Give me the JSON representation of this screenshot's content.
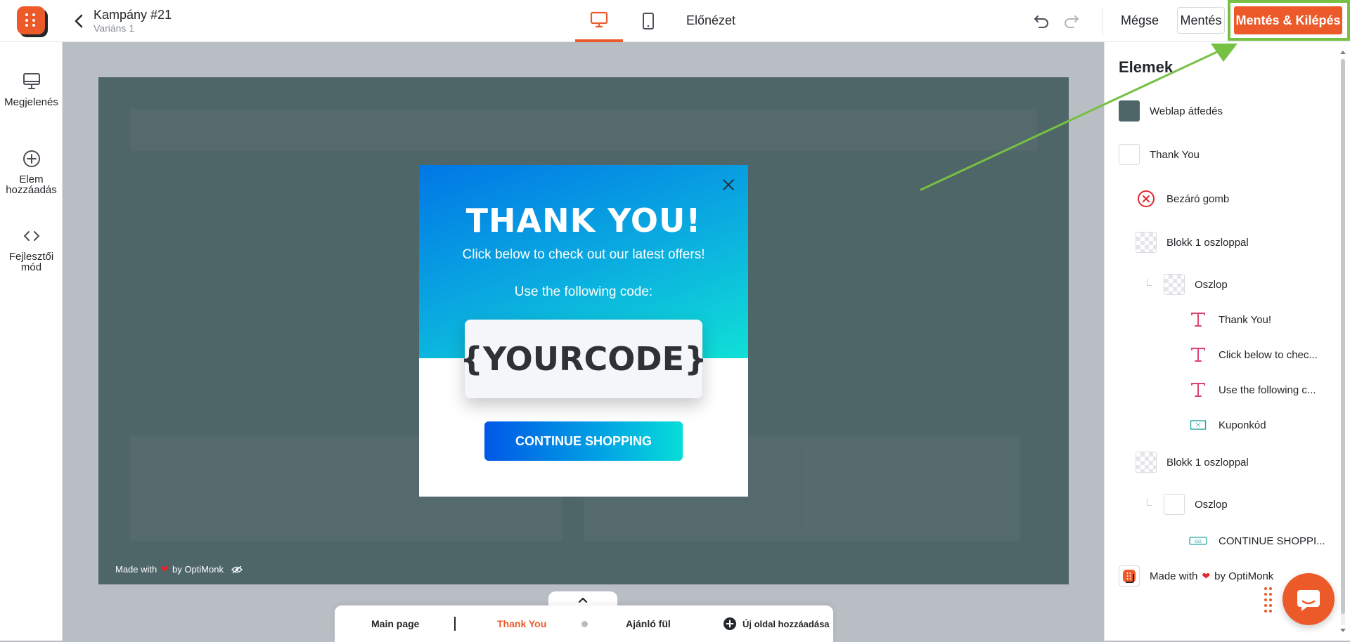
{
  "header": {
    "campaign_title": "Kampány #21",
    "variant": "Variáns 1",
    "preview_label": "Előnézet",
    "cancel_label": "Mégse",
    "save_label": "Mentés",
    "save_exit_label": "Mentés & Kilépés",
    "active_device": "desktop"
  },
  "sidebar": {
    "items": [
      {
        "label": "Megjelenés",
        "icon": "monitor-icon"
      },
      {
        "label": "Elem hozzáadás",
        "icon": "plus-circle-icon"
      },
      {
        "label": "Fejlesztői mód",
        "icon": "code-icon"
      }
    ]
  },
  "popup": {
    "title": "THANK YOU!",
    "text1": "Click below to check out our latest offers!",
    "text2": "Use the following code:",
    "coupon_code": "{YOURCODE}",
    "cta_label": "CONTINUE SHOPPING",
    "gradient_start": "#0077e6",
    "gradient_end": "#10e0d6"
  },
  "canvas": {
    "made_with_prefix": "Made with",
    "made_with_suffix": "by OptiMonk",
    "overlay_color": "#4f6669"
  },
  "page_tabs": {
    "tabs": [
      "Main page",
      "Thank You",
      "Ajánló fül"
    ],
    "active_tab": "Thank You",
    "add_page_label": "Új oldal hozzáadása"
  },
  "elements_panel": {
    "title": "Elemek",
    "layers": [
      {
        "label": "Weblap átfedés",
        "type": "swatch-dark"
      },
      {
        "label": "Thank You",
        "type": "swatch-white"
      },
      {
        "label": "Bezáró gomb",
        "type": "close-icon"
      },
      {
        "label": "Blokk 1 oszloppal",
        "type": "swatch-checker"
      },
      {
        "label": "Oszlop",
        "type": "swatch-checker"
      },
      {
        "label": "Thank You!",
        "type": "text-icon"
      },
      {
        "label": "Click below to chec...",
        "type": "text-icon"
      },
      {
        "label": "Use the following c...",
        "type": "text-icon"
      },
      {
        "label": "Kuponkód",
        "type": "coupon-icon"
      },
      {
        "label": "Blokk 1 oszloppal",
        "type": "swatch-checker"
      },
      {
        "label": "Oszlop",
        "type": "swatch-white"
      },
      {
        "label": "CONTINUE SHOPPI...",
        "type": "button-icon"
      },
      {
        "label_prefix": "Made with",
        "label_suffix": "by OptiMonk",
        "type": "logo-icon"
      }
    ]
  },
  "colors": {
    "brand": "#ed5a29",
    "highlight": "#76c043",
    "text_icon": "#e0436f",
    "coupon_icon": "#2aa6a6"
  }
}
